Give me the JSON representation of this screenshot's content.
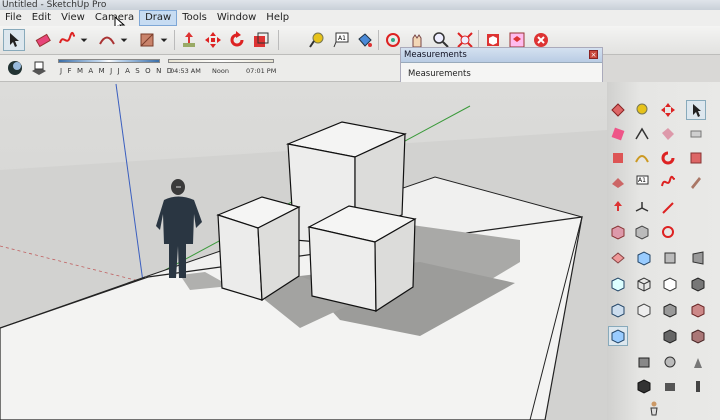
{
  "window": {
    "title": "Untitled - SketchUp Pro"
  },
  "menu": {
    "items": [
      "File",
      "Edit",
      "View",
      "Camera",
      "Draw",
      "Tools",
      "Window",
      "Help"
    ],
    "active": "Draw"
  },
  "shadows": {
    "months": "J F M A M J J A S O N D",
    "time_start": "04:53 AM",
    "time_mid": "Noon",
    "time_end": "07:01 PM"
  },
  "measurements": {
    "title": "Measurements",
    "label": "Measurements",
    "close": "×"
  },
  "toolbar_icons": [
    "select-icon",
    "eraser-icon",
    "freehand-icon",
    "arc-icon",
    "rectangle-icon",
    "push-pull-icon",
    "move-icon",
    "rotate-icon",
    "scale-icon",
    "tape-measure-icon",
    "text-icon",
    "paint-bucket-icon",
    "orbit-icon",
    "pan-icon",
    "zoom-extents-icon",
    "3d-warehouse-icon",
    "components-icon",
    "extension-warehouse-icon"
  ],
  "colors": {
    "accent_red": "#d83a3a",
    "axis_red": "#c0392b",
    "axis_green": "#3a9a3a",
    "axis_blue": "#3b5fbf"
  }
}
